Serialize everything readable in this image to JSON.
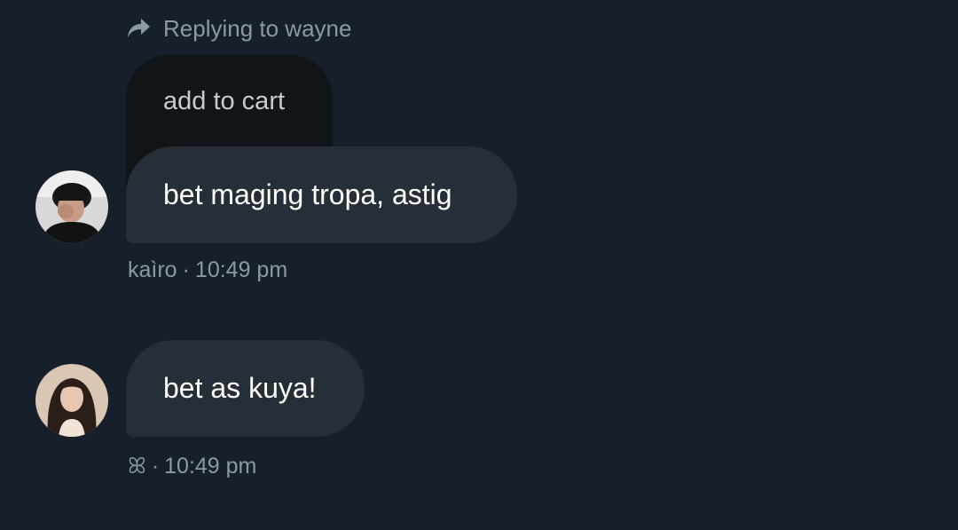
{
  "reply": {
    "label": "Replying to wayne",
    "icon": "reply-arrow-icon"
  },
  "quoted_message": {
    "text": "add to cart"
  },
  "messages": [
    {
      "text": "bet maging tropa, astig",
      "sender": "kaìro",
      "separator": "·",
      "time": "10:49 pm",
      "avatar": "avatar-kairo"
    },
    {
      "text": "bet as kuya!",
      "sender": "ꕤ",
      "separator": "·",
      "time": "10:49 pm",
      "avatar": "avatar-second-user"
    }
  ],
  "colors": {
    "background": "#17202a",
    "bubble": "#262f38",
    "quoted_bubble": "#111518",
    "meta_text": "#8b98a5",
    "message_text": "#ffffff"
  }
}
